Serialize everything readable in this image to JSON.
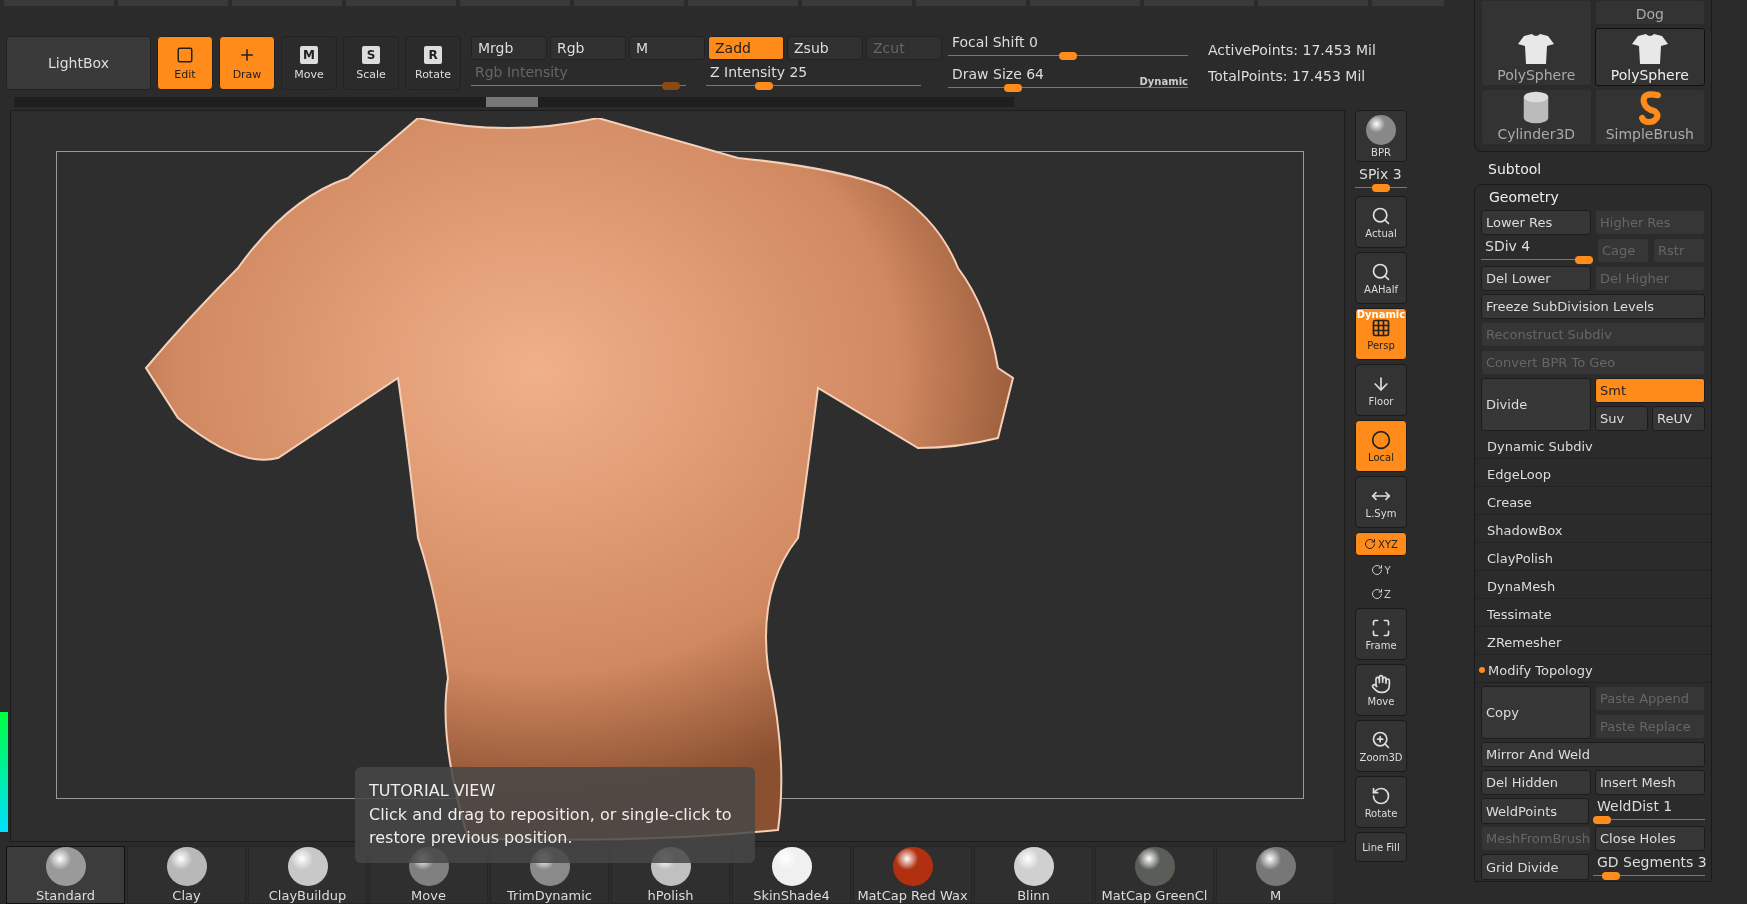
{
  "toolbar": {
    "lightbox": "LightBox",
    "tools": [
      {
        "label": "Edit",
        "kind": "edit",
        "selected": true
      },
      {
        "label": "Draw",
        "kind": "draw",
        "selected": true
      },
      {
        "label": "Move",
        "kind": "letter",
        "key": "M",
        "selected": false
      },
      {
        "label": "Scale",
        "kind": "letter",
        "key": "S",
        "selected": false
      },
      {
        "label": "Rotate",
        "kind": "letter",
        "key": "R",
        "selected": false
      }
    ],
    "modes": [
      {
        "label": "Mrgb",
        "selected": false,
        "disabled": false
      },
      {
        "label": "Rgb",
        "selected": false,
        "disabled": false
      },
      {
        "label": "M",
        "selected": false,
        "disabled": false
      },
      {
        "label": "Zadd",
        "selected": true,
        "disabled": false
      },
      {
        "label": "Zsub",
        "selected": false,
        "disabled": false
      },
      {
        "label": "Zcut",
        "selected": false,
        "disabled": true
      }
    ],
    "rgb_intensity": {
      "label": "Rgb Intensity",
      "disabled": true,
      "level": 0.97
    },
    "z_intensity": {
      "label": "Z Intensity",
      "value": "25",
      "disabled": false,
      "level": 0.25
    },
    "focal_shift": {
      "label": "Focal Shift",
      "value": "0",
      "level": 0.5
    },
    "draw_size": {
      "label": "Draw Size",
      "value": "64",
      "badge": "Dynamic",
      "level": 0.25
    },
    "active_points": "ActivePoints: 17.453 Mil",
    "total_points": "TotalPoints: 17.453 Mil"
  },
  "tutorial": {
    "title": "TUTORIAL VIEW",
    "text": "Click and drag to reposition, or single-click to restore previous position."
  },
  "view_controls": [
    {
      "kind": "bpr",
      "label": "BPR",
      "selected": false
    },
    {
      "kind": "slider",
      "label": "SPix 3",
      "level": 0.5
    },
    {
      "kind": "actual",
      "label": "Actual",
      "selected": false
    },
    {
      "kind": "aahalf",
      "label": "AAHalf",
      "selected": false
    },
    {
      "kind": "persp",
      "label": "Persp",
      "badge": "Dynamic",
      "selected": true
    },
    {
      "kind": "floor",
      "label": "Floor",
      "selected": false
    },
    {
      "kind": "local",
      "label": "Local",
      "selected": true
    },
    {
      "kind": "lsym",
      "label": "L.Sym",
      "selected": false
    },
    {
      "kind": "xyz",
      "label": "XYZ",
      "selected": true
    },
    {
      "kind": "axis",
      "label": "Y",
      "selected": false
    },
    {
      "kind": "axis",
      "label": "Z",
      "selected": false
    },
    {
      "kind": "frame",
      "label": "Frame",
      "selected": false
    },
    {
      "kind": "move",
      "label": "Move",
      "selected": false
    },
    {
      "kind": "zoom",
      "label": "Zoom3D",
      "selected": false
    },
    {
      "kind": "rotate",
      "label": "Rotate",
      "selected": false
    },
    {
      "kind": "linefill",
      "label": "Line Fill",
      "selected": false
    }
  ],
  "materials": [
    {
      "label": "Standard",
      "color": "#9a9a9a",
      "selected": true
    },
    {
      "label": "Clay",
      "color": "#b8b8b8",
      "selected": false
    },
    {
      "label": "ClayBuildup",
      "color": "#c8c8c8",
      "selected": false
    },
    {
      "label": "Move",
      "color": "#808080",
      "selected": false
    },
    {
      "label": "TrimDynamic",
      "color": "#8a8a8a",
      "selected": false
    },
    {
      "label": "hPolish",
      "color": "#c0c0c0",
      "selected": false
    },
    {
      "label": "SkinShade4",
      "color": "#f0f0f0",
      "selected": false
    },
    {
      "label": "MatCap Red Wax",
      "color": "#b03010",
      "selected": false
    },
    {
      "label": "Blinn",
      "color": "#d0d0d0",
      "selected": false
    },
    {
      "label": "MatCap GreenCl",
      "color": "#5a5e58",
      "selected": false
    },
    {
      "label": "M",
      "color": "#777777",
      "selected": false
    }
  ],
  "tool_palette": {
    "thumbnails": [
      {
        "label": "Dog",
        "kind": "none",
        "selected": false
      },
      {
        "label": "PolySphere",
        "kind": "shirt",
        "selected": false
      },
      {
        "label": "PolySphere",
        "kind": "shirt",
        "selected": true
      },
      {
        "label": "Cylinder3D",
        "kind": "cylinder",
        "selected": false
      },
      {
        "label": "SimpleBrush",
        "kind": "brush",
        "selected": false
      }
    ],
    "subtool": "Subtool",
    "geometry": "Geometry",
    "rows": [
      {
        "kind": "pair",
        "items": [
          {
            "label": "Lower Res",
            "disabled": false
          },
          {
            "label": "Higher Res",
            "disabled": true
          }
        ]
      },
      {
        "kind": "sdiv",
        "slider": {
          "label": "SDiv 4",
          "level": 1
        },
        "items": [
          {
            "label": "Cage",
            "disabled": true
          },
          {
            "label": "Rstr",
            "disabled": true
          }
        ]
      },
      {
        "kind": "pair",
        "items": [
          {
            "label": "Del Lower",
            "disabled": false
          },
          {
            "label": "Del Higher",
            "disabled": true
          }
        ]
      },
      {
        "kind": "wide",
        "items": [
          {
            "label": "Freeze SubDivision Levels",
            "disabled": false
          }
        ]
      },
      {
        "kind": "wide",
        "items": [
          {
            "label": "Reconstruct Subdiv",
            "disabled": true
          }
        ]
      },
      {
        "kind": "wide",
        "items": [
          {
            "label": "Convert BPR To Geo",
            "disabled": true
          }
        ]
      },
      {
        "kind": "divide",
        "items": [
          {
            "label": "Divide",
            "disabled": false
          },
          {
            "label": "Smt",
            "disabled": false,
            "selected": true
          },
          {
            "label": "Suv",
            "disabled": false,
            "selected": false
          },
          {
            "label": "ReUV",
            "disabled": false,
            "selected": false
          }
        ]
      },
      {
        "kind": "section",
        "label": "Dynamic Subdiv",
        "dot": false
      },
      {
        "kind": "section",
        "label": "EdgeLoop",
        "dot": false
      },
      {
        "kind": "section",
        "label": "Crease",
        "dot": false
      },
      {
        "kind": "section",
        "label": "ShadowBox",
        "dot": false
      },
      {
        "kind": "section",
        "label": "ClayPolish",
        "dot": false
      },
      {
        "kind": "section",
        "label": "DynaMesh",
        "dot": false
      },
      {
        "kind": "section",
        "label": "Tessimate",
        "dot": false
      },
      {
        "kind": "section",
        "label": "ZRemesher",
        "dot": false
      },
      {
        "kind": "section",
        "label": "Modify Topology",
        "dot": true
      },
      {
        "kind": "copy",
        "items": [
          {
            "label": "Copy",
            "disabled": false
          },
          {
            "label": "Paste Append",
            "disabled": true
          },
          {
            "label": "Paste Replace",
            "disabled": true
          }
        ]
      },
      {
        "kind": "wide",
        "items": [
          {
            "label": "Mirror And Weld",
            "disabled": false
          }
        ]
      },
      {
        "kind": "pair",
        "items": [
          {
            "label": "Del Hidden",
            "disabled": false
          },
          {
            "label": "Insert Mesh",
            "disabled": false
          }
        ]
      },
      {
        "kind": "weld",
        "slider": {
          "label": "WeldDist 1",
          "level": 0
        },
        "items": [
          {
            "label": "WeldPoints",
            "disabled": false
          }
        ]
      },
      {
        "kind": "pair",
        "items": [
          {
            "label": "MeshFromBrush",
            "disabled": true
          },
          {
            "label": "Close Holes",
            "disabled": false
          }
        ]
      },
      {
        "kind": "grid",
        "slider": {
          "label": "GD Segments 3",
          "level": 0.1
        },
        "items": [
          {
            "label": "Grid Divide",
            "disabled": false
          }
        ]
      }
    ]
  }
}
